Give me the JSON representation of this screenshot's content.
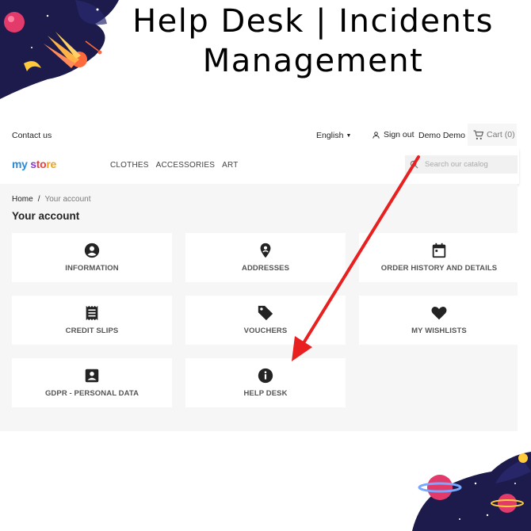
{
  "promo": {
    "title_line1": "Help Desk | Incidents",
    "title_line2": "Management"
  },
  "topbar": {
    "contact": "Contact us",
    "language": "English",
    "signout": "Sign out",
    "username": "Demo Demo",
    "cart": "Cart (0)"
  },
  "header": {
    "logo": [
      "my",
      " ",
      "s",
      "to",
      "re"
    ],
    "nav": [
      "CLOTHES",
      "ACCESSORIES",
      "ART"
    ],
    "search_placeholder": "Search our catalog"
  },
  "breadcrumb": {
    "home": "Home",
    "separator": "/",
    "current": "Your account"
  },
  "page_title": "Your account",
  "tiles": [
    {
      "label": "INFORMATION",
      "icon": "user-circle-icon"
    },
    {
      "label": "ADDRESSES",
      "icon": "location-pin-icon"
    },
    {
      "label": "ORDER HISTORY AND DETAILS",
      "icon": "calendar-icon"
    },
    {
      "label": "CREDIT SLIPS",
      "icon": "receipt-icon"
    },
    {
      "label": "VOUCHERS",
      "icon": "tag-icon"
    },
    {
      "label": "MY WISHLISTS",
      "icon": "heart-icon"
    },
    {
      "label": "GDPR - PERSONAL DATA",
      "icon": "account-box-icon"
    },
    {
      "label": "HELP DESK",
      "icon": "info-icon"
    }
  ],
  "colors": {
    "annotation_arrow": "#e8201f",
    "icon": "#232323",
    "panel_bg": "#f6f6f6"
  }
}
